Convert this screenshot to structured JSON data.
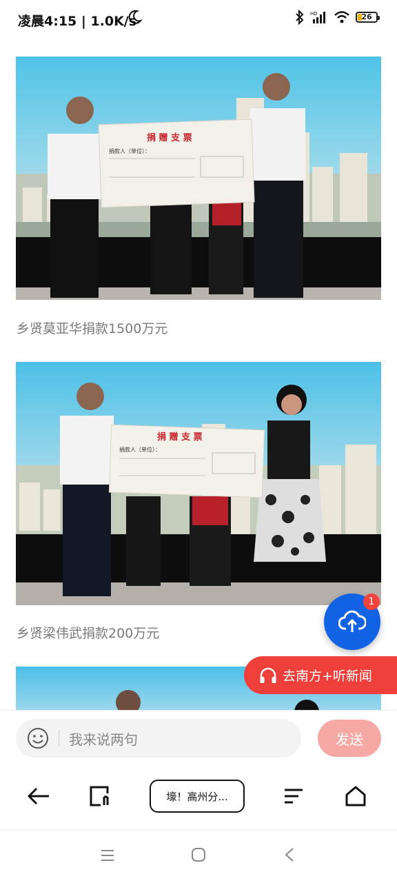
{
  "status_bar": {
    "time_text": "凌晨4:15 | 1.0K/s",
    "battery": "26"
  },
  "articles": [
    {
      "caption": "乡贤莫亚华捐款1500万元",
      "cheque_title": "捐 赠 支 票",
      "donor_line": "捐款人（单位）："
    },
    {
      "caption": "乡贤梁伟武捐款200万元",
      "cheque_title": "捐 赠 支 票",
      "donor_line": "捐款人（单位）："
    }
  ],
  "fab": {
    "badge": "1",
    "icon": "cloud-upload-icon"
  },
  "listen_button": {
    "label": "去南方+听新闻",
    "icon": "headphones-icon"
  },
  "comment": {
    "placeholder": "我来说两句",
    "send_label": "发送"
  },
  "toolbar": {
    "title_chip": "壕！高州分..."
  },
  "colors": {
    "accent_blue": "#1262e6",
    "accent_red": "#ee3f3a",
    "send_disabled": "#f5a8a4"
  }
}
